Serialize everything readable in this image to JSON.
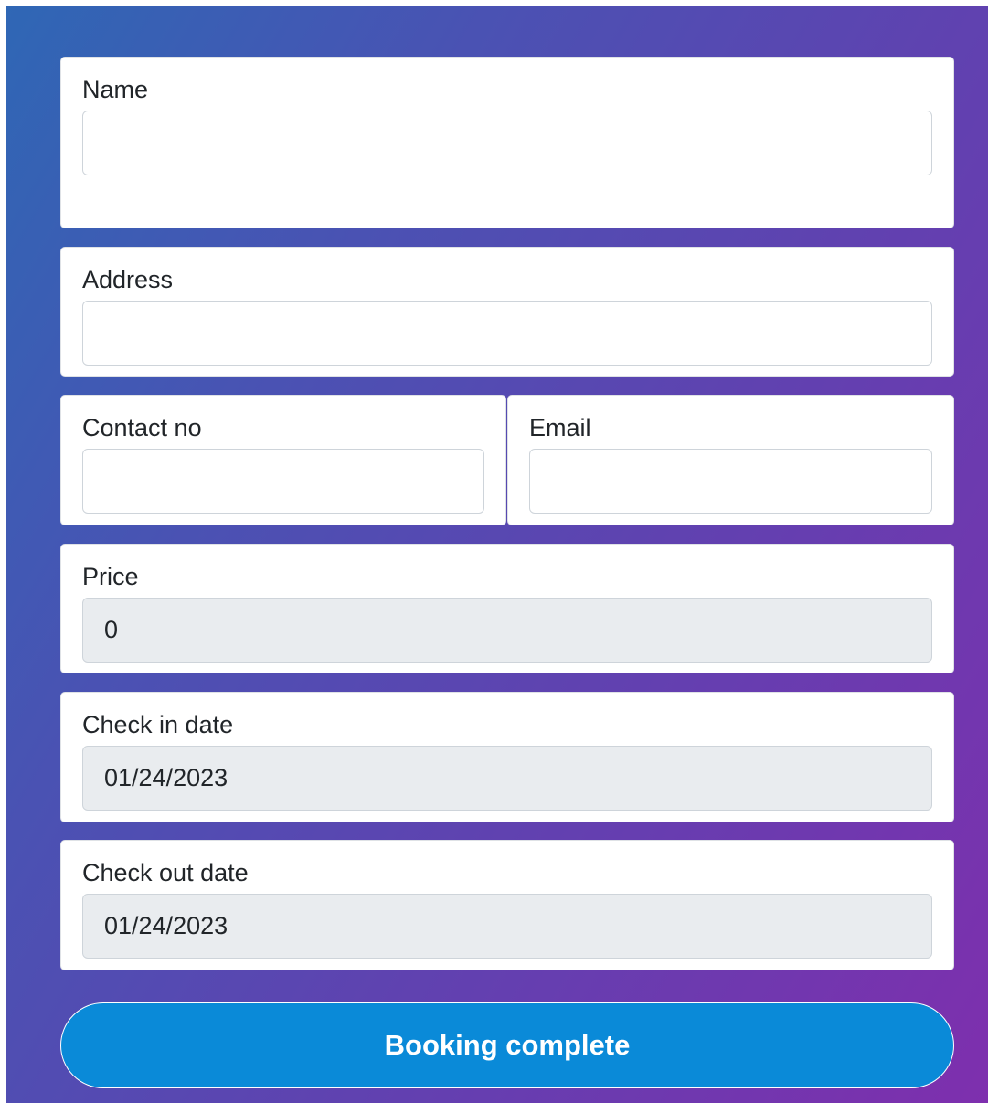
{
  "form": {
    "name": {
      "label": "Name",
      "value": ""
    },
    "address": {
      "label": "Address",
      "value": ""
    },
    "contact": {
      "label": "Contact no",
      "value": ""
    },
    "email": {
      "label": "Email",
      "value": ""
    },
    "price": {
      "label": "Price",
      "value": "0"
    },
    "checkin": {
      "label": "Check in date",
      "value": "01/24/2023"
    },
    "checkout": {
      "label": "Check out date",
      "value": "01/24/2023"
    },
    "submit_label": "Booking complete"
  },
  "colors": {
    "gradient_start": "#2f67b5",
    "gradient_end": "#7e2fae",
    "button": "#0a8ad8",
    "readonly_field": "#e9ecef"
  }
}
